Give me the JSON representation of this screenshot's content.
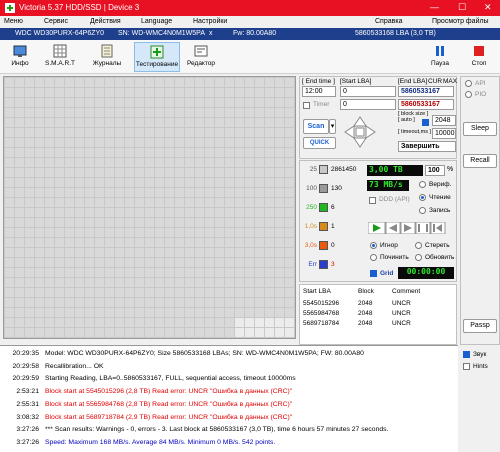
{
  "window": {
    "title": "Victoria 5.37 HDD/SSD | Device 3",
    "minimize": "—",
    "maximize": "☐",
    "close": "✕"
  },
  "menu": {
    "items": [
      "Меню",
      "Сервис",
      "Действия",
      "Language",
      "Настройки"
    ],
    "help": "Справка",
    "photo_viewer": "Просмотр файлы"
  },
  "drive": {
    "model": "WDC WD30PURX-64P6ZY0",
    "serial": "SN: WD-WMC4N0M1W5PA",
    "close_mark": "x",
    "firmware": "Fw: 80.00A80",
    "lba": "5860533168 LBA (3,0 TB)"
  },
  "toolbar": {
    "buttons": [
      "Инфо",
      "S.M.A.R.T",
      "Журналы",
      "Тестирование",
      "Редактор"
    ],
    "pause": "Пауза",
    "stop": "Стоп"
  },
  "scan": {
    "end_time_label": "[ End time ]",
    "start_lba_label": "[Start LBA]",
    "end_lba_label": "[End LBA]",
    "cur_label": "CUR",
    "max_label": "MAX",
    "end_time": "12:00",
    "start_lba": "0",
    "end_lba": "5860533167",
    "end_lba_2": "5860533167",
    "timer_label": "Timer",
    "timer_value": "0",
    "block_size_label": "[ block size ]",
    "auto_label": "[ auto ]",
    "block_size": "2048",
    "timeout_label": "[ timeout,ms ]",
    "timeout": "10000",
    "scan_button": "Scan",
    "quick_button": "QUICK",
    "action": "Завершить"
  },
  "side": {
    "api": "API",
    "pio": "PIO",
    "sleep": "Sleep",
    "recall": "Recall",
    "passp": "Passp",
    "sound": "Звук",
    "hints": "Hints"
  },
  "stats": {
    "blocks": [
      {
        "ms": "25",
        "count": "2861450",
        "color": "#c8c8c8"
      },
      {
        "ms": "100",
        "count": "130",
        "color": "#9a9a9a"
      },
      {
        "ms": "250",
        "count": "6",
        "color": "#1fb81f"
      },
      {
        "ms": "1,0s",
        "count": "1",
        "color": "#d58a1a"
      },
      {
        "ms": "3,0s",
        "count": "0",
        "color": "#e85a10"
      },
      {
        "ms": "Err",
        "count": "3",
        "color": "#2a3ccc"
      }
    ],
    "size": "3,00 TB",
    "percent": "100",
    "percent_unit": "%",
    "speed": "73 MB/s",
    "ddd": "DDD (API)",
    "verify": "Вериф.",
    "read": "Чтение",
    "write": "Запись",
    "ignore": "Игнор",
    "erase": "Стереть",
    "remap": "Починить",
    "refresh": "Обновить",
    "grid_label": "Grid",
    "clock": "00:00:00"
  },
  "bad_table": {
    "headers": [
      "Start LBA",
      "Block",
      "Comment"
    ],
    "rows": [
      [
        "5545015296",
        "2048",
        "UNCR"
      ],
      [
        "5565984768",
        "2048",
        "UNCR"
      ],
      [
        "5689718784",
        "2048",
        "UNCR"
      ]
    ]
  },
  "log": [
    {
      "time": "20:29:35",
      "text": "Model: WDC WD30PURX-64P6ZY0; Size 5860533168 LBAs; SN: WD-WMC4N0M1W5PA; FW: 80.00A80",
      "kind": "normal"
    },
    {
      "time": "20:29:58",
      "text": "Recallibration... OK",
      "kind": "normal"
    },
    {
      "time": "20:29:59",
      "text": "Starting Reading, LBA=0..5860533167, FULL, sequential access, timeout 10000ms",
      "kind": "normal"
    },
    {
      "time": "2:53:21",
      "text": "Block start at 5545015296 (2,8 TB) Read error: UNCR \"Ошибка в данных (CRC)\"",
      "kind": "err"
    },
    {
      "time": "2:55:31",
      "text": "Block start at 5565984768 (2,8 TB) Read error: UNCR \"Ошибка в данных (CRC)\"",
      "kind": "err"
    },
    {
      "time": "3:08:32",
      "text": "Block start at 5689718784 (2,9 TB) Read error: UNCR \"Ошибка в данных (CRC)\"",
      "kind": "err"
    },
    {
      "time": "3:27:26",
      "text": "*** Scan results: Warnings - 0, errors - 3. Last block at 5860533167 (3,0 TB), time 6 hours 57 minutes 27 seconds.",
      "kind": "normal"
    },
    {
      "time": "3:27:26",
      "text": "Speed: Maximum 168 MB/s. Average 84 MB/s. Minimum 0 MB/s. 542 points.",
      "kind": "info"
    }
  ]
}
